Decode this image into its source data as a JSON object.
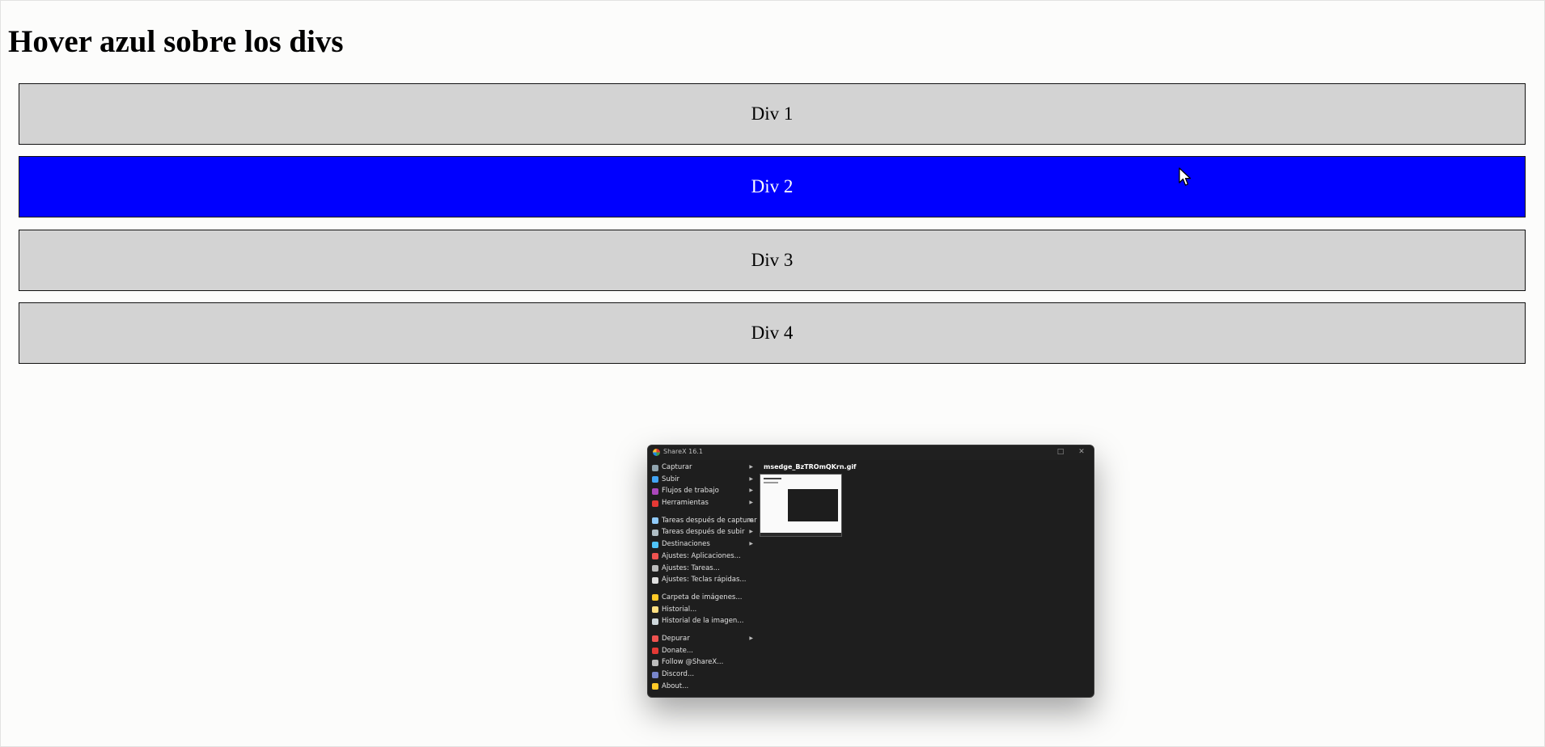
{
  "page": {
    "heading": "Hover azul sobre los divs"
  },
  "divs": [
    {
      "label": "Div 1",
      "hovered": false,
      "color": "#d3d3d3"
    },
    {
      "label": "Div 2",
      "hovered": true,
      "color": "#0000ff"
    },
    {
      "label": "Div 3",
      "hovered": false,
      "color": "#d3d3d3"
    },
    {
      "label": "Div 4",
      "hovered": false,
      "color": "#d3d3d3"
    }
  ],
  "cursor_icon": "arrow-cursor-icon",
  "sharex": {
    "title": "ShareX 16.1",
    "maximize_glyph": "□",
    "close_glyph": "✕",
    "menu": [
      {
        "label": "Capturar",
        "submenu": true,
        "icon": "monitor-icon",
        "color": "#90a4ae"
      },
      {
        "label": "Subir",
        "submenu": true,
        "icon": "upload-icon",
        "color": "#42a5f5"
      },
      {
        "label": "Flujos de trabajo",
        "submenu": true,
        "icon": "workflow-icon",
        "color": "#ab47bc"
      },
      {
        "label": "Herramientas",
        "submenu": true,
        "icon": "toolbox-icon",
        "color": "#e53935"
      },
      {
        "label": "Tareas después de capturar",
        "submenu": true,
        "icon": "after-capture-icon",
        "color": "#90caf9",
        "sep_before": true
      },
      {
        "label": "Tareas después de subir",
        "submenu": true,
        "icon": "after-upload-icon",
        "color": "#b0bec5"
      },
      {
        "label": "Destinaciones",
        "submenu": true,
        "icon": "destinations-icon",
        "color": "#4fc3f7"
      },
      {
        "label": "Ajustes: Aplicaciones...",
        "submenu": false,
        "icon": "app-settings-icon",
        "color": "#ef5350"
      },
      {
        "label": "Ajustes: Tareas...",
        "submenu": false,
        "icon": "gear-icon",
        "color": "#bdbdbd"
      },
      {
        "label": "Ajustes: Teclas rápidas...",
        "submenu": false,
        "icon": "keyboard-icon",
        "color": "#e0e0e0"
      },
      {
        "label": "Carpeta de imágenes...",
        "submenu": false,
        "icon": "folder-icon",
        "color": "#ffca28",
        "sep_before": true
      },
      {
        "label": "Historial...",
        "submenu": false,
        "icon": "history-icon",
        "color": "#ffe082"
      },
      {
        "label": "Historial de la imagen...",
        "submenu": false,
        "icon": "image-history-icon",
        "color": "#cfd8dc"
      },
      {
        "label": "Depurar",
        "submenu": true,
        "icon": "debug-icon",
        "color": "#ef5350",
        "sep_before": true
      },
      {
        "label": "Donate...",
        "submenu": false,
        "icon": "heart-icon",
        "color": "#e53935"
      },
      {
        "label": "Follow @ShareX...",
        "submenu": false,
        "icon": "x-logo-icon",
        "color": "#bdbdbd"
      },
      {
        "label": "Discord...",
        "submenu": false,
        "icon": "discord-icon",
        "color": "#7986cb"
      },
      {
        "label": "About...",
        "submenu": false,
        "icon": "crown-icon",
        "color": "#ffca28"
      }
    ],
    "thumbnail": {
      "filename": "msedge_BzTROmQKrn.gif"
    }
  }
}
